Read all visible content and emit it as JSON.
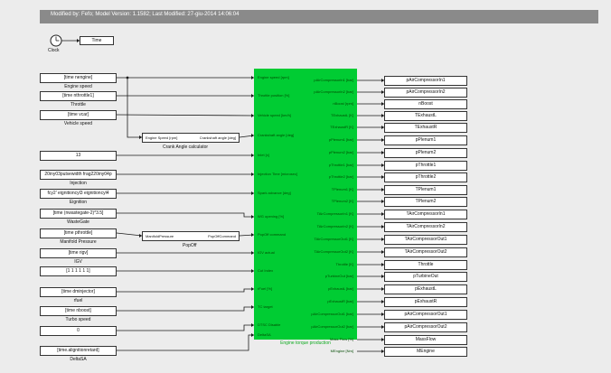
{
  "header": {
    "text": "Modified by: Fefo; Model Version: 1.1582; Last Modified: 27-giu-2014 14:06:04"
  },
  "clock": {
    "label": "Clock",
    "output": "Time",
    "icon": "clock-icon"
  },
  "sources": [
    {
      "text": "[time nengine]",
      "label": "Engine speed"
    },
    {
      "text": "[time nthrottle1]",
      "label": "Throttle"
    },
    {
      "text": "[time vcar]",
      "label": "Vehicle speed"
    },
    {
      "text": "13",
      "label": ""
    },
    {
      "text": "20iny03pulsewidth frag220iny04p",
      "label": "Injection"
    },
    {
      "text": "fcy2' eignitioncyl3 eignitioncyl4",
      "label": "Eignition"
    },
    {
      "text": "[time (nwastegate-2)*3.5]",
      "label": "WasteGate"
    },
    {
      "text": "[time pthrottle]",
      "label": "Manifold Pressure"
    },
    {
      "text": "[time rigv]",
      "label": "IGV"
    },
    {
      "text": "[1 1 1 1 1 1]",
      "label": ""
    },
    {
      "text": "[time dminjector]",
      "label": "rfuel"
    },
    {
      "text": "[time nboost]",
      "label": "Turbo speed"
    },
    {
      "text": "0",
      "label": ""
    },
    {
      "text": "[time.alignitionretard]",
      "label": "DeltaSA"
    }
  ],
  "crank_block": {
    "in_port": "Engine Speed [rpm]",
    "out_port": "Crankshaft angle [deg]",
    "label": "Crank Angle calculator"
  },
  "popoff_block": {
    "in_port": "ManifoldPressure",
    "out_port": "PopOffCommand",
    "label": "PopOff"
  },
  "engine": {
    "title": "Engine torque production",
    "inputs": [
      "Engine speed [rpm]",
      "Throttle position [%]",
      "Vehicle speed [km/h]",
      "Crankshaft angle [deg]",
      "Inlet [x]",
      "Injection Time [microsec]",
      "Spark advance [deg]",
      "WG opening [%]",
      "PopOff command",
      "IGV actual",
      "Cut Index",
      "rFuel [%]",
      "TC target",
      "DTSC Disable",
      "DeltaSA"
    ],
    "outputs": [
      "pAirCompressorIn1 [bar]",
      "pAirCompressorIn2 [bar]",
      "nBoost [rpm]",
      "TExhaustL [K]",
      "TExhaustR [K]",
      "pPlenum1 [bar]",
      "pPlenum2 [bar]",
      "pThrottle1 [bar]",
      "pThrottle2 [bar]",
      "TPlenum1 [K]",
      "TPlenum2 [K]",
      "TAirCompressorIn1 [K]",
      "TAirCompressorIn2 [K]",
      "TAirCompressorOut1 [K]",
      "TAirCompressorOut2 [K]",
      "Throttle [K]",
      "pTurbineOut [bar]",
      "pExhaustL [bar]",
      "pExhaustR [bar]",
      "pAirCompressorOut1 [bar]",
      "pAirCompressorOut2 [bar]",
      "Mass Flow [%]",
      "MEngine [Nm]"
    ]
  },
  "sinks": [
    "pAirCompressorIn1",
    "pAirCompressorIn2",
    "nBoost",
    "TExhaustL",
    "TExhaustR",
    "pPlenum1",
    "pPlenum2",
    "pThrottle1",
    "pThrottle2",
    "TPlenum1",
    "TPlenum2",
    "TAirCompressorIn1",
    "TAirCompressorIn2",
    "TAirCompressorOut1",
    "TAirCompressorOut2",
    "Throttle",
    "pTurbineOut",
    "pExhaustL",
    "pExhaustR",
    "pAirCompressorOut1",
    "pAirCompressorOut2",
    "MassFlow",
    "MEngine"
  ]
}
